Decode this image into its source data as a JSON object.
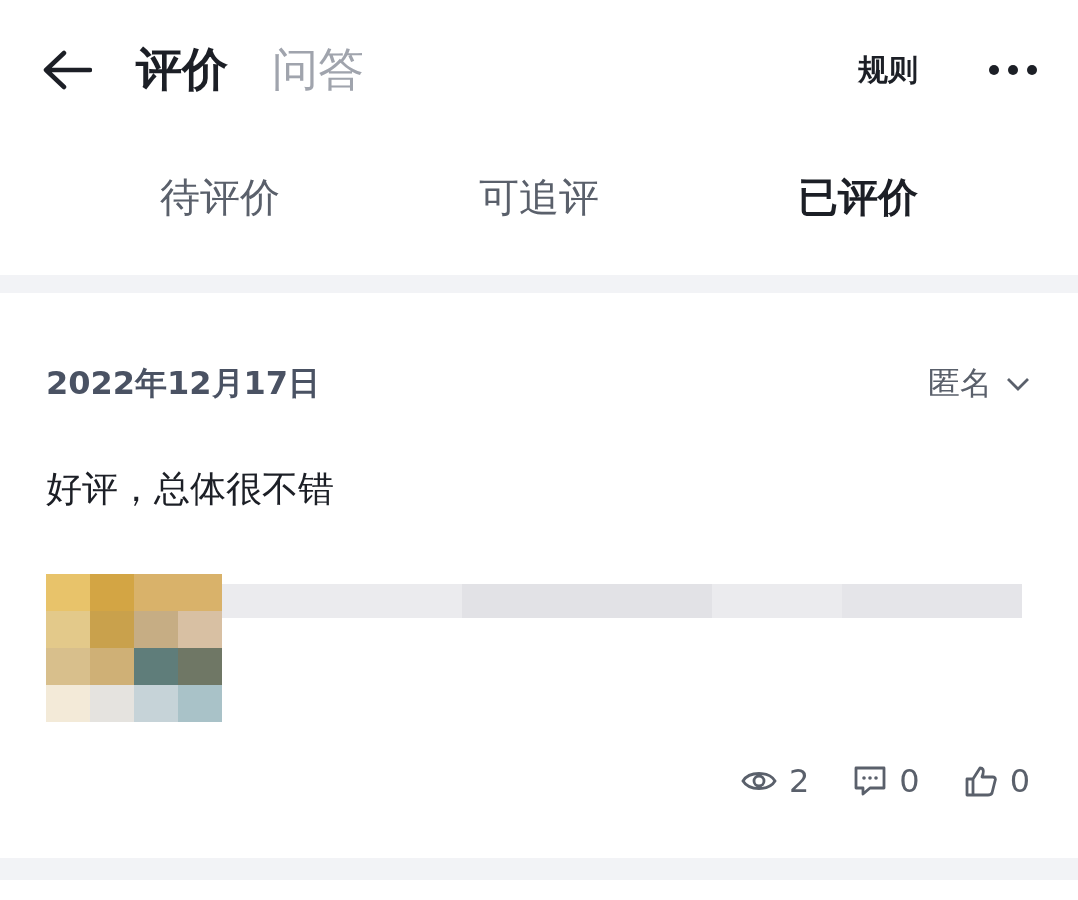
{
  "header": {
    "tabs": [
      {
        "label": "评价",
        "selected": true
      },
      {
        "label": "问答",
        "selected": false
      }
    ],
    "rules": "规则"
  },
  "filter_tabs": [
    {
      "label": "待评价",
      "selected": false
    },
    {
      "label": "可追评",
      "selected": false
    },
    {
      "label": "已评价",
      "selected": true
    }
  ],
  "review": {
    "date": "2022年12月17日",
    "visibility": "匿名",
    "text": "好评，总体很不错",
    "stats": [
      {
        "kind": "views",
        "count": "2"
      },
      {
        "kind": "comments",
        "count": "0"
      },
      {
        "kind": "likes",
        "count": "0"
      }
    ]
  }
}
